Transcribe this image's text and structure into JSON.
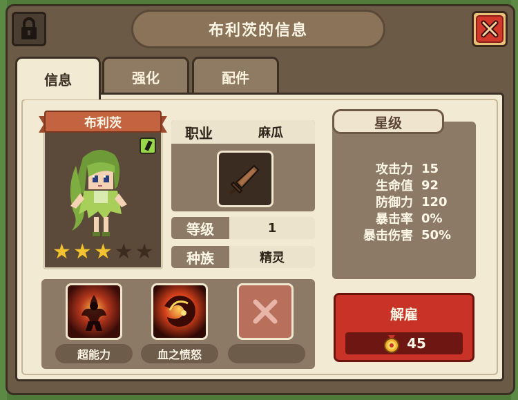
{
  "header": {
    "title": "布利茨的信息",
    "lock_icon": "lock-icon",
    "close_icon": "close-icon"
  },
  "tabs": [
    {
      "label": "信息",
      "active": true
    },
    {
      "label": "强化",
      "active": false
    },
    {
      "label": "配件",
      "active": false
    }
  ],
  "hero": {
    "name": "布利茨",
    "stars_filled": 3,
    "stars_total": 5,
    "job_label": "职业",
    "job_value": "麻瓜",
    "level_label": "等级",
    "level_value": "1",
    "race_label": "种族",
    "race_value": "精灵"
  },
  "star_panel": {
    "title": "星级",
    "stats": [
      {
        "label": "攻击力",
        "value": "15"
      },
      {
        "label": "生命值",
        "value": "92"
      },
      {
        "label": "防御力",
        "value": "120"
      },
      {
        "label": "暴击率",
        "value": "0%"
      },
      {
        "label": "暴击伤害",
        "value": "50%"
      }
    ]
  },
  "skills": [
    {
      "label": "超能力",
      "icon": "super-power-icon"
    },
    {
      "label": "血之愤怒",
      "icon": "blood-rage-icon"
    },
    {
      "label": "",
      "icon": "empty-slot-x-icon"
    }
  ],
  "dismiss": {
    "label": "解雇",
    "cost": "45",
    "cost_icon": "medal-icon"
  },
  "colors": {
    "panel_bg": "#f3ead4",
    "frame": "#6b5a45",
    "dismiss_red": "#c93226",
    "star_gold": "#f2c230"
  }
}
